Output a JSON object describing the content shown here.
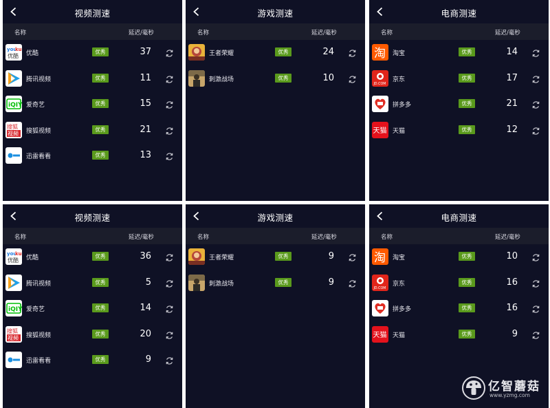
{
  "common": {
    "col_name": "名称",
    "col_latency": "延迟/毫秒",
    "badge_label": "优秀",
    "badge_color": "#5a9a1c",
    "background": "#0f1125",
    "header_bg": "#1b1d2b"
  },
  "panels": [
    {
      "title": "视频测速",
      "items": [
        {
          "name": "优酷",
          "icon": "youku-icon",
          "latency": "37"
        },
        {
          "name": "腾讯视频",
          "icon": "tencent-video-icon",
          "latency": "11"
        },
        {
          "name": "爱奇艺",
          "icon": "iqiyi-icon",
          "latency": "15"
        },
        {
          "name": "搜狐视频",
          "icon": "sohu-video-icon",
          "latency": "21"
        },
        {
          "name": "迅雷看看",
          "icon": "xunlei-kankan-icon",
          "latency": "13"
        }
      ]
    },
    {
      "title": "游戏测速",
      "items": [
        {
          "name": "王者荣耀",
          "icon": "honor-of-kings-icon",
          "latency": "24"
        },
        {
          "name": "刺激战场",
          "icon": "pubg-icon",
          "latency": "10"
        }
      ]
    },
    {
      "title": "电商测速",
      "items": [
        {
          "name": "淘宝",
          "icon": "taobao-icon",
          "latency": "14"
        },
        {
          "name": "京东",
          "icon": "jd-icon",
          "latency": "17"
        },
        {
          "name": "拼多多",
          "icon": "pinduoduo-icon",
          "latency": "21"
        },
        {
          "name": "天猫",
          "icon": "tmall-icon",
          "latency": "12"
        }
      ]
    },
    {
      "title": "视频测速",
      "items": [
        {
          "name": "优酷",
          "icon": "youku-icon",
          "latency": "36"
        },
        {
          "name": "腾讯视频",
          "icon": "tencent-video-icon",
          "latency": "5"
        },
        {
          "name": "爱奇艺",
          "icon": "iqiyi-icon",
          "latency": "14"
        },
        {
          "name": "搜狐视频",
          "icon": "sohu-video-icon",
          "latency": "20"
        },
        {
          "name": "迅雷看看",
          "icon": "xunlei-kankan-icon",
          "latency": "9"
        }
      ]
    },
    {
      "title": "游戏测速",
      "items": [
        {
          "name": "王者荣耀",
          "icon": "honor-of-kings-icon",
          "latency": "9"
        },
        {
          "name": "刺激战场",
          "icon": "pubg-icon",
          "latency": "9"
        }
      ]
    },
    {
      "title": "电商测速",
      "items": [
        {
          "name": "淘宝",
          "icon": "taobao-icon",
          "latency": "10"
        },
        {
          "name": "京东",
          "icon": "jd-icon",
          "latency": "16"
        },
        {
          "name": "拼多多",
          "icon": "pinduoduo-icon",
          "latency": "16"
        },
        {
          "name": "天猫",
          "icon": "tmall-icon",
          "latency": "9"
        }
      ]
    }
  ],
  "watermark": {
    "name": "亿智蘑菇",
    "url": "www.yzmg.com"
  }
}
